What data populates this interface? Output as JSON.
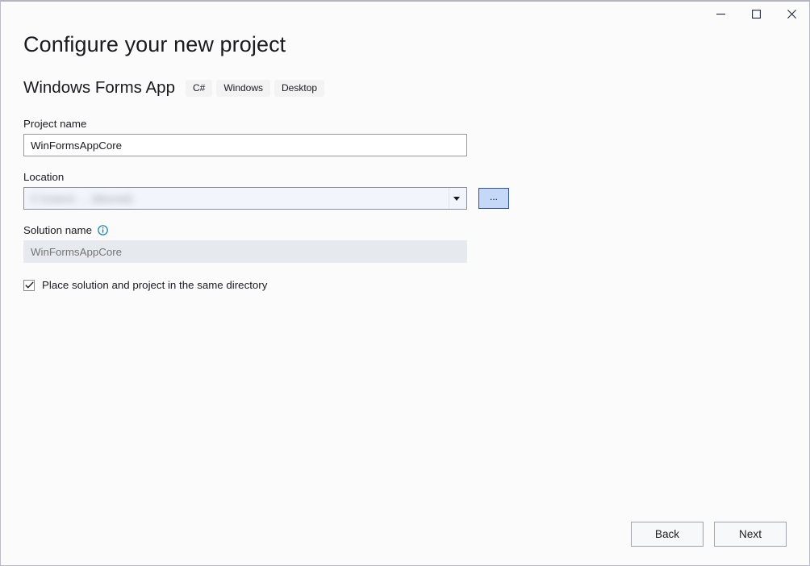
{
  "window": {
    "controls": {
      "minimize": "minimize-icon",
      "maximize": "maximize-icon",
      "close": "close-icon"
    }
  },
  "page": {
    "title": "Configure your new project",
    "template_name": "Windows Forms App",
    "tags": [
      "C#",
      "Windows",
      "Desktop"
    ]
  },
  "form": {
    "project_name": {
      "label": "Project name",
      "value": "WinFormsAppCore",
      "placeholder": ""
    },
    "location": {
      "label": "Location",
      "value": "C:\\Users\\ … (blurred)",
      "browse_label": "...",
      "dropdown_icon": "chevron-down-icon"
    },
    "solution_name": {
      "label": "Solution name",
      "value": "",
      "placeholder": "WinFormsAppCore",
      "disabled": true,
      "info_icon": "info-icon"
    },
    "same_directory": {
      "label": "Place solution and project in the same directory",
      "checked": true,
      "check_glyph": "✓"
    }
  },
  "footer": {
    "back_label": "Back",
    "next_label": "Next"
  },
  "colors": {
    "window_bg": "#fbfbfb",
    "text": "#1b1b1f",
    "border": "#9a9a9a",
    "tag_bg": "#f3f3f3",
    "combo_bg": "#f2f5fc",
    "browse_bg": "#c5d8f7",
    "browse_border": "#2f4f8f",
    "disabled_bg": "#e6e9ed",
    "info_accent": "#0e7fa8"
  }
}
